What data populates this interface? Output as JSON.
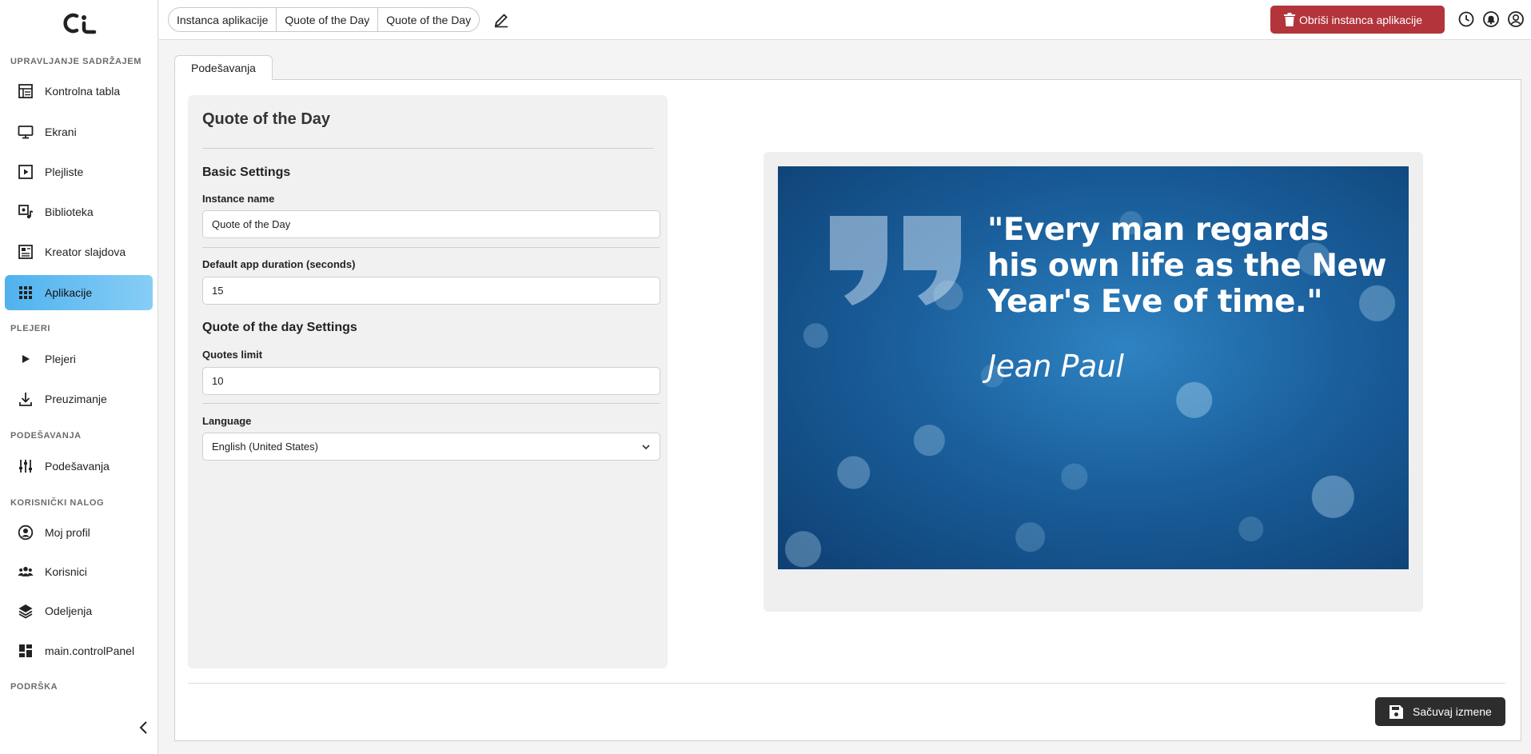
{
  "sidebar": {
    "sections": [
      {
        "label": "UPRAVLJANJE SADRŽAJEM"
      },
      {
        "label": "PLEJERI"
      },
      {
        "label": "PODEŠAVANJA"
      },
      {
        "label": "KORISNIČKI NALOG"
      },
      {
        "label": "PODRŠKA"
      }
    ],
    "items": [
      {
        "label": "Kontrolna tabla",
        "icon": "dashboard-icon"
      },
      {
        "label": "Ekrani",
        "icon": "monitor-icon"
      },
      {
        "label": "Plejliste",
        "icon": "playlist-icon"
      },
      {
        "label": "Biblioteka",
        "icon": "library-icon"
      },
      {
        "label": "Kreator slajdova",
        "icon": "slide-creator-icon"
      },
      {
        "label": "Aplikacije",
        "icon": "apps-grid-icon",
        "active": true
      },
      {
        "label": "Plejeri",
        "icon": "play-icon"
      },
      {
        "label": "Preuzimanje",
        "icon": "download-icon"
      },
      {
        "label": "Podešavanja",
        "icon": "sliders-icon"
      },
      {
        "label": "Moj profil",
        "icon": "user-circle-icon"
      },
      {
        "label": "Korisnici",
        "icon": "users-icon"
      },
      {
        "label": "Odeljenja",
        "icon": "layers-icon"
      },
      {
        "label": "main.controlPanel",
        "icon": "control-panel-icon"
      }
    ]
  },
  "topbar": {
    "breadcrumb": [
      "Instanca aplikacije",
      "Quote of the Day",
      "Quote of the Day"
    ],
    "delete_label": "Obriši instanca aplikacije",
    "accent_delete": "#b3343b"
  },
  "tabs": [
    {
      "label": "Podešavanja"
    }
  ],
  "form": {
    "title": "Quote of the Day",
    "basic_settings": "Basic Settings",
    "instance_name_label": "Instance name",
    "instance_name_value": "Quote of the Day",
    "duration_label": "Default app duration (seconds)",
    "duration_value": "15",
    "quote_settings": "Quote of the day Settings",
    "quotes_limit_label": "Quotes limit",
    "quotes_limit_value": "10",
    "language_label": "Language",
    "language_value": "English (United States)"
  },
  "preview": {
    "quote": "\"Every man regards his own life as the New Year's Eve of time.\"",
    "author": "Jean Paul"
  },
  "footer": {
    "save_label": "Sačuvaj izmene"
  }
}
